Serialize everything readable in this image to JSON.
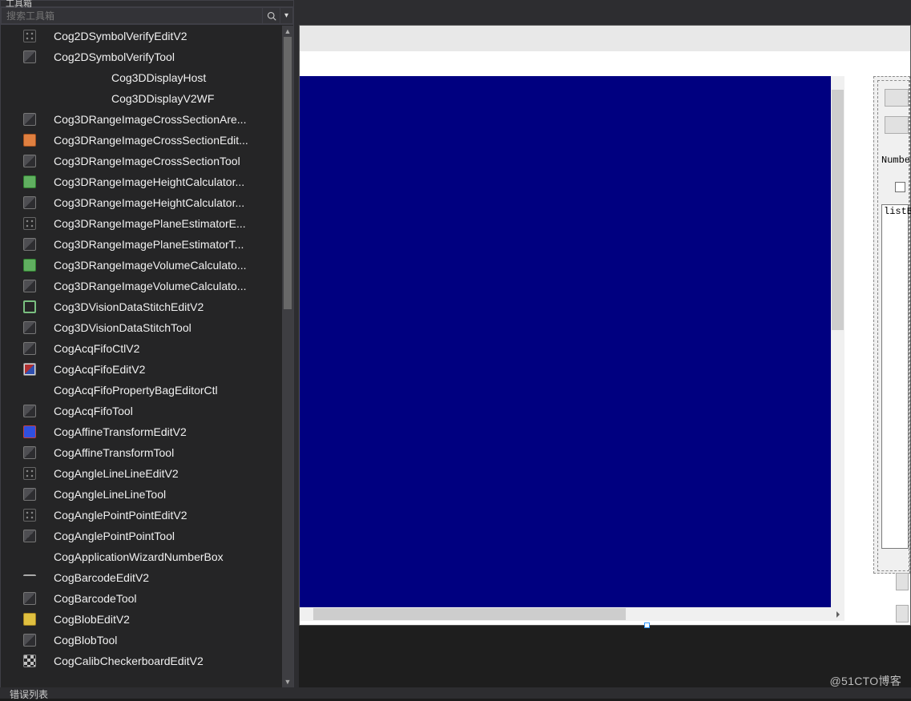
{
  "toolbox": {
    "title": "工具箱",
    "search_placeholder": "搜索工具箱",
    "items": [
      {
        "icon": "dots",
        "label": "Cog2DSymbolVerifyEditV2"
      },
      {
        "icon": "gen",
        "label": "Cog2DSymbolVerifyTool"
      },
      {
        "icon": "none",
        "label": "Cog3DDisplayHost",
        "sub": true
      },
      {
        "icon": "none",
        "label": "Cog3DDisplayV2WF",
        "sub": true
      },
      {
        "icon": "gen",
        "label": "Cog3DRangeImageCrossSectionAre..."
      },
      {
        "icon": "orange",
        "label": "Cog3DRangeImageCrossSectionEdit..."
      },
      {
        "icon": "gen",
        "label": "Cog3DRangeImageCrossSectionTool"
      },
      {
        "icon": "green",
        "label": "Cog3DRangeImageHeightCalculator..."
      },
      {
        "icon": "gen",
        "label": "Cog3DRangeImageHeightCalculator..."
      },
      {
        "icon": "dots",
        "label": "Cog3DRangeImagePlaneEstimatorE..."
      },
      {
        "icon": "gen",
        "label": "Cog3DRangeImagePlaneEstimatorT..."
      },
      {
        "icon": "green",
        "label": "Cog3DRangeImageVolumeCalculato..."
      },
      {
        "icon": "gen",
        "label": "Cog3DRangeImageVolumeCalculato..."
      },
      {
        "icon": "crop",
        "label": "Cog3DVisionDataStitchEditV2"
      },
      {
        "icon": "gen",
        "label": "Cog3DVisionDataStitchTool"
      },
      {
        "icon": "gen",
        "label": "CogAcqFifoCtlV2"
      },
      {
        "icon": "pic",
        "label": "CogAcqFifoEditV2"
      },
      {
        "icon": "none",
        "label": "CogAcqFifoPropertyBagEditorCtl"
      },
      {
        "icon": "gen",
        "label": "CogAcqFifoTool"
      },
      {
        "icon": "red",
        "label": "CogAffineTransformEditV2"
      },
      {
        "icon": "gen",
        "label": "CogAffineTransformTool"
      },
      {
        "icon": "dots",
        "label": "CogAngleLineLineEditV2"
      },
      {
        "icon": "gen",
        "label": "CogAngleLineLineTool"
      },
      {
        "icon": "dots",
        "label": "CogAnglePointPointEditV2"
      },
      {
        "icon": "gen",
        "label": "CogAnglePointPointTool"
      },
      {
        "icon": "none",
        "label": "CogApplicationWizardNumberBox"
      },
      {
        "icon": "dash",
        "label": "CogBarcodeEditV2"
      },
      {
        "icon": "gen",
        "label": "CogBarcodeTool"
      },
      {
        "icon": "yellow",
        "label": "CogBlobEditV2"
      },
      {
        "icon": "gen",
        "label": "CogBlobTool"
      },
      {
        "icon": "chk",
        "label": "CogCalibCheckerboardEditV2"
      }
    ]
  },
  "designer": {
    "right_panel": {
      "label_number": "Number:",
      "listbox_value": "listB"
    }
  },
  "bottom_bar": {
    "label": "错误列表"
  },
  "watermark": "@51CTO博客"
}
